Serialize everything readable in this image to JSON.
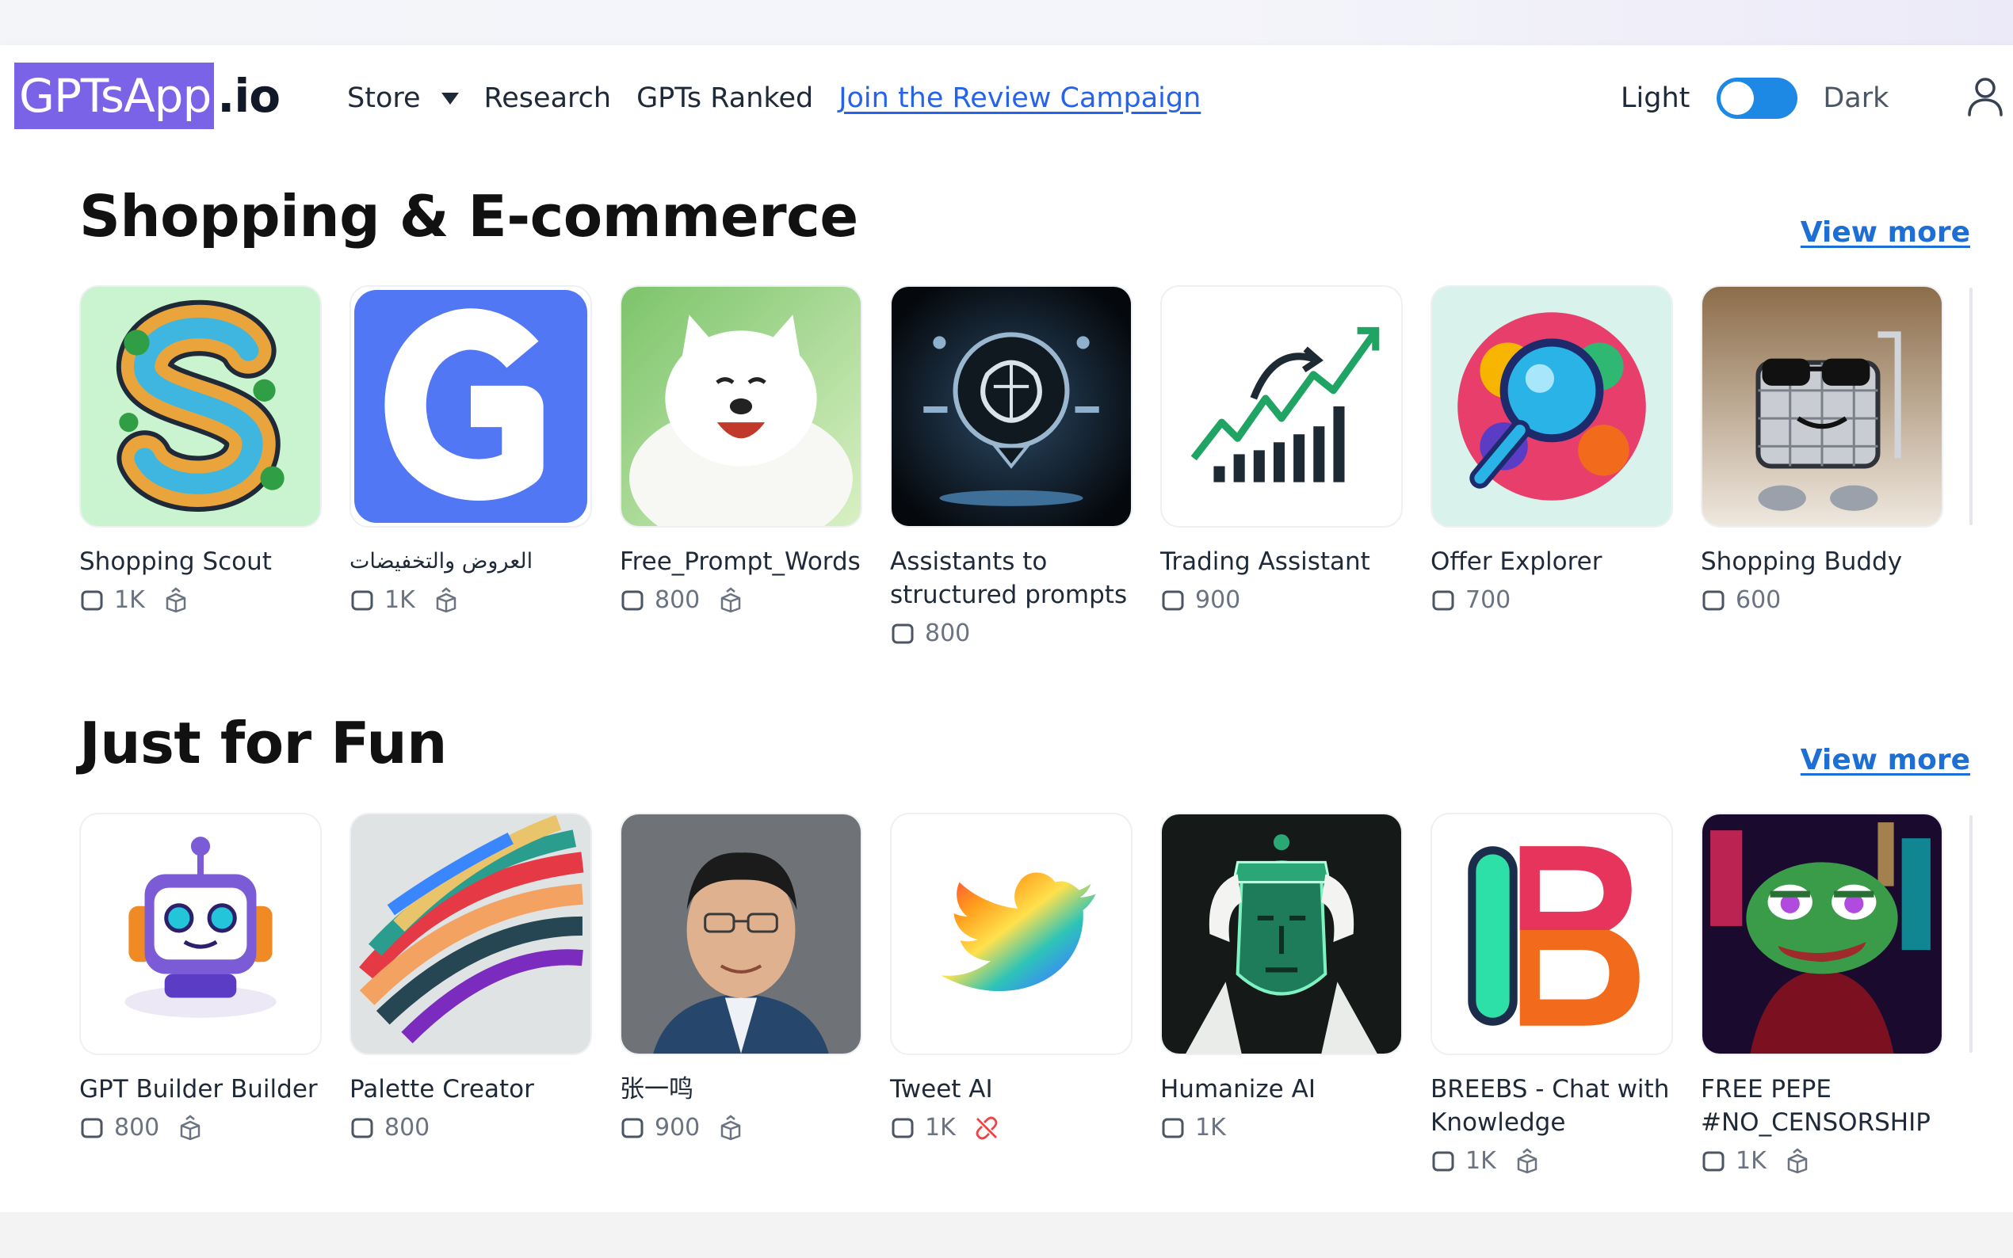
{
  "header": {
    "logo_box": "GPTsApp",
    "logo_tail": ".io",
    "nav": {
      "store": "Store",
      "research": "Research",
      "ranked": "GPTs Ranked",
      "campaign": "Join the Review Campaign"
    },
    "theme": {
      "light": "Light",
      "dark": "Dark",
      "dark_enabled": false
    }
  },
  "sections": [
    {
      "title": "Shopping & E-commerce",
      "view_more": "View more",
      "cards": [
        {
          "name": "Shopping Scout",
          "count": "1K",
          "icon": "box-icon"
        },
        {
          "name": "العروض والتخفيضات",
          "count": "1K",
          "icon": "box-icon"
        },
        {
          "name": "Free_Prompt_Words",
          "count": "800",
          "icon": "box-icon"
        },
        {
          "name": "Assistants to structured prompts",
          "count": "800",
          "icon": ""
        },
        {
          "name": "Trading Assistant",
          "count": "900",
          "icon": ""
        },
        {
          "name": "Offer Explorer",
          "count": "700",
          "icon": ""
        },
        {
          "name": "Shopping Buddy",
          "count": "600",
          "icon": ""
        }
      ]
    },
    {
      "title": "Just for Fun",
      "view_more": "View more",
      "cards": [
        {
          "name": "GPT Builder Builder",
          "count": "800",
          "icon": "box-icon"
        },
        {
          "name": "Palette Creator",
          "count": "800",
          "icon": ""
        },
        {
          "name": "张一鸣",
          "count": "900",
          "icon": "box-icon"
        },
        {
          "name": "Tweet AI",
          "count": "1K",
          "icon": "broken-link-icon"
        },
        {
          "name": "Humanize AI",
          "count": "1K",
          "icon": ""
        },
        {
          "name": "BREEBS - Chat with Knowledge",
          "count": "1K",
          "icon": "box-icon"
        },
        {
          "name": "FREE PEPE #NO_CENSORSHIP",
          "count": "1K",
          "icon": "box-icon"
        }
      ]
    }
  ],
  "colors": {
    "brand": "#7a63e6",
    "link": "#2563eb",
    "toggle": "#1e88e5",
    "view_more": "#1d6fd6"
  }
}
